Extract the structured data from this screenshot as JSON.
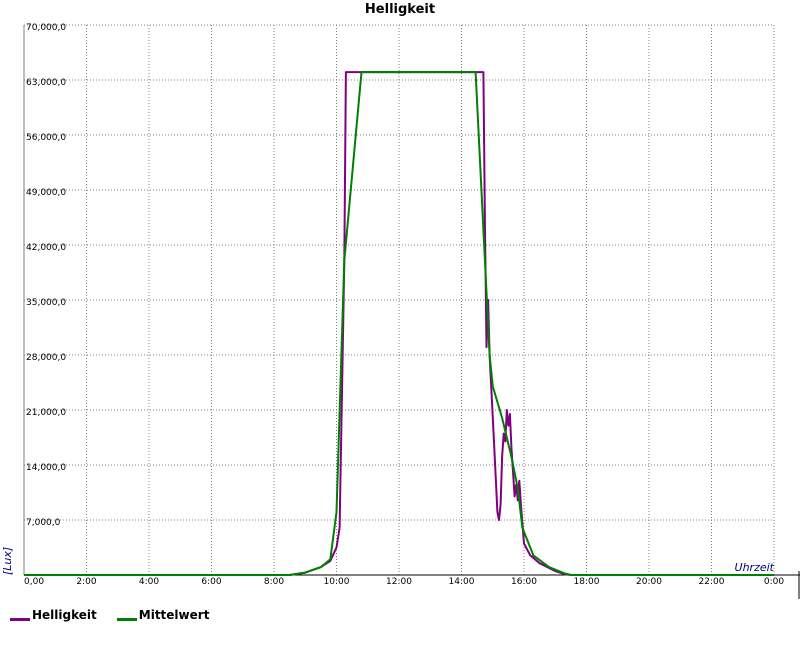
{
  "chart_data": {
    "type": "line",
    "title": "Helligkeit",
    "xlabel": "Uhrzeit",
    "ylabel": "[Lux]",
    "xlim": [
      0,
      24
    ],
    "ylim": [
      0,
      70000
    ],
    "x_tick_labels": [
      "0,00",
      "2:00",
      "4:00",
      "6:00",
      "8:00",
      "10:00",
      "12:00",
      "14:00",
      "16:00",
      "18:00",
      "20:00",
      "22:00",
      "0:00"
    ],
    "y_tick_labels": [
      "70,000,0",
      "63,000,0",
      "56,000,0",
      "49,000,0",
      "42,000,0",
      "35,000,0",
      "28,000,0",
      "21,000,0",
      "14,000,0",
      "7,000,0"
    ],
    "grid": true,
    "legend_position": "bottom-left",
    "series": [
      {
        "name": "Helligkeit",
        "color": "#800080",
        "points": [
          [
            0,
            0
          ],
          [
            8.5,
            0
          ],
          [
            9.0,
            300
          ],
          [
            9.5,
            1000
          ],
          [
            9.8,
            1800
          ],
          [
            10.0,
            3500
          ],
          [
            10.1,
            6000
          ],
          [
            10.25,
            40000
          ],
          [
            10.3,
            64000
          ],
          [
            14.7,
            64000
          ],
          [
            14.75,
            45000
          ],
          [
            14.8,
            29000
          ],
          [
            14.85,
            35000
          ],
          [
            14.9,
            28000
          ],
          [
            15.0,
            20000
          ],
          [
            15.1,
            12000
          ],
          [
            15.15,
            8000
          ],
          [
            15.2,
            7000
          ],
          [
            15.25,
            9000
          ],
          [
            15.3,
            15000
          ],
          [
            15.35,
            18000
          ],
          [
            15.4,
            17000
          ],
          [
            15.45,
            21000
          ],
          [
            15.5,
            19000
          ],
          [
            15.55,
            20500
          ],
          [
            15.6,
            16000
          ],
          [
            15.65,
            13000
          ],
          [
            15.7,
            10000
          ],
          [
            15.75,
            11500
          ],
          [
            15.8,
            9500
          ],
          [
            15.85,
            12000
          ],
          [
            15.9,
            9000
          ],
          [
            16.0,
            4000
          ],
          [
            16.2,
            2500
          ],
          [
            16.5,
            1500
          ],
          [
            17.0,
            500
          ],
          [
            17.3,
            100
          ],
          [
            17.5,
            0
          ],
          [
            24,
            0
          ]
        ]
      },
      {
        "name": "Mittelwert",
        "color": "#008000",
        "points": [
          [
            0,
            0
          ],
          [
            8.5,
            0
          ],
          [
            9.0,
            300
          ],
          [
            9.5,
            1000
          ],
          [
            9.8,
            2000
          ],
          [
            10.0,
            8000
          ],
          [
            10.25,
            40000
          ],
          [
            10.8,
            64000
          ],
          [
            14.45,
            64000
          ],
          [
            14.9,
            28000
          ],
          [
            15.0,
            24000
          ],
          [
            15.3,
            20000
          ],
          [
            15.6,
            15000
          ],
          [
            15.8,
            11000
          ],
          [
            15.95,
            6000
          ],
          [
            16.3,
            2500
          ],
          [
            16.8,
            1000
          ],
          [
            17.3,
            200
          ],
          [
            17.5,
            0
          ],
          [
            24,
            0
          ]
        ]
      }
    ]
  }
}
